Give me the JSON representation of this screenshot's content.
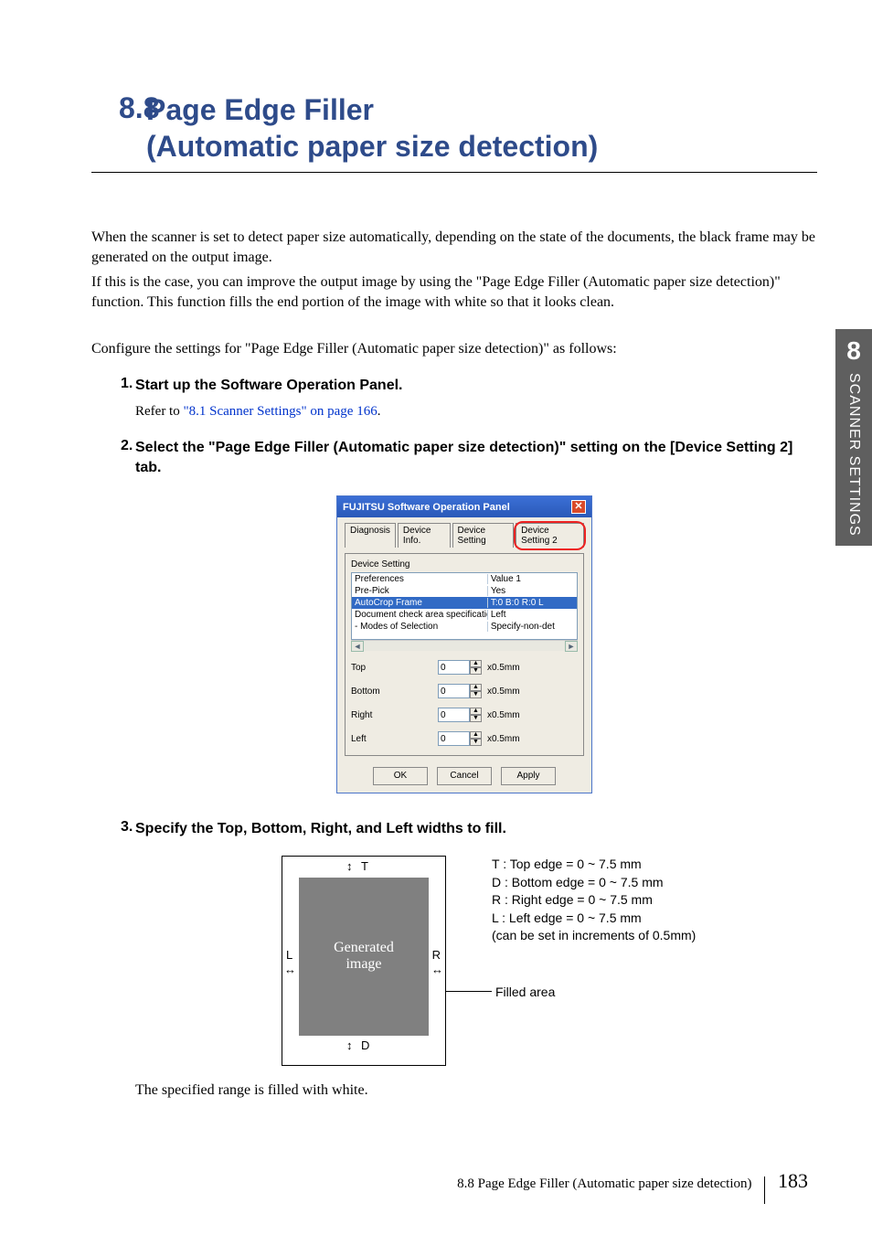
{
  "heading": {
    "number": "8.8",
    "title_line1": "Page Edge Filler",
    "title_line2": "(Automatic paper size detection)"
  },
  "intro": {
    "p1": "When the scanner is set to detect paper size automatically, depending on the state of the documents, the black frame may be generated on the output image.",
    "p2": "If this is the case, you can improve the output image by using the \"Page Edge Filler (Automatic paper size detection)\" function. This function fills the end portion of the image with white so that it looks clean.",
    "config": "Configure the settings for \"Page Edge Filler (Automatic paper size detection)\" as follows:"
  },
  "steps": {
    "s1": {
      "num": "1.",
      "title": "Start up the Software Operation Panel.",
      "refer_prefix": "Refer to ",
      "refer_link": "\"8.1 Scanner Settings\" on page 166",
      "refer_suffix": "."
    },
    "s2": {
      "num": "2.",
      "title": "Select the \"Page Edge Filler (Automatic paper size detection)\" setting on the [Device Setting 2] tab."
    },
    "s3": {
      "num": "3.",
      "title": "Specify the Top, Bottom, Right, and Left widths to fill.",
      "note": "The specified range is filled with white."
    }
  },
  "dialog": {
    "title": "FUJITSU Software Operation Panel",
    "tabs": [
      "Diagnosis",
      "Device Info.",
      "Device Setting",
      "Device Setting 2"
    ],
    "section_label": "Device Setting",
    "list": [
      {
        "c1": "Preferences",
        "c2": "Value 1"
      },
      {
        "c1": "Pre-Pick",
        "c2": "Yes"
      },
      {
        "c1": "AutoCrop Frame",
        "c2": "T:0 B:0 R:0 L",
        "hi": true
      },
      {
        "c1": "Document check area specification for ...",
        "c2": "Left"
      },
      {
        "c1": "- Modes of Selection",
        "c2": "Specify-non-det"
      }
    ],
    "fields": [
      {
        "label": "Top",
        "value": "0",
        "unit": "x0.5mm"
      },
      {
        "label": "Bottom",
        "value": "0",
        "unit": "x0.5mm"
      },
      {
        "label": "Right",
        "value": "0",
        "unit": "x0.5mm"
      },
      {
        "label": "Left",
        "value": "0",
        "unit": "x0.5mm"
      }
    ],
    "buttons": {
      "ok": "OK",
      "cancel": "Cancel",
      "apply": "Apply"
    }
  },
  "fig2": {
    "inner_line1": "Generated",
    "inner_line2": "image",
    "T": "T",
    "D": "D",
    "L": "L",
    "R": "R",
    "legend": [
      "T : Top edge = 0 ~ 7.5 mm",
      "D : Bottom edge = 0 ~ 7.5 mm",
      "R : Right edge = 0 ~ 7.5 mm",
      "L : Left edge = 0 ~ 7.5 mm",
      "(can be set in increments of 0.5mm)"
    ],
    "filled_area": "Filled area"
  },
  "side": {
    "chapnum": "8",
    "chapname": "SCANNER SETTINGS"
  },
  "footer": {
    "text": "8.8 Page Edge Filler (Automatic paper size detection)",
    "page": "183"
  }
}
